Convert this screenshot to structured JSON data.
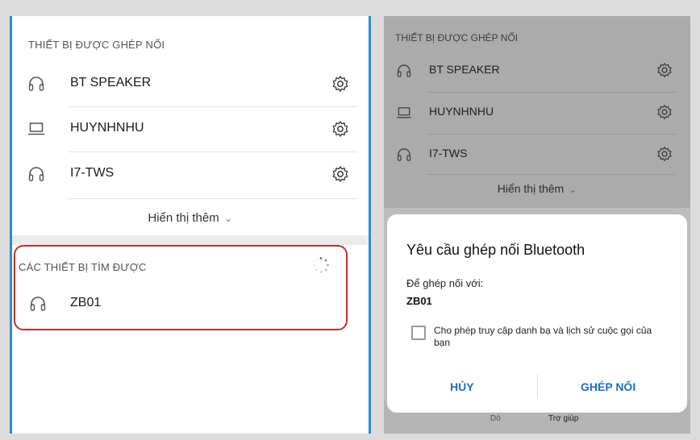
{
  "left": {
    "paired_header": "THIẾT BỊ ĐƯỢC GHÉP NỐI",
    "paired_devices": [
      {
        "label": "BT SPEAKER",
        "icon": "headphones-icon"
      },
      {
        "label": "HUYNHNHU",
        "icon": "laptop-icon"
      },
      {
        "label": "I7-TWS",
        "icon": "headphones-icon"
      }
    ],
    "show_more": "Hiển thị thêm",
    "found_header": "CÁC THIẾT BỊ TÌM ĐƯỢC",
    "found_devices": [
      {
        "label": "ZB01",
        "icon": "headphones-icon"
      }
    ]
  },
  "right": {
    "paired_header": "THIẾT BỊ ĐƯỢC GHÉP NỐI",
    "paired_devices": [
      {
        "label": "BT SPEAKER",
        "icon": "headphones-icon"
      },
      {
        "label": "HUYNHNHU",
        "icon": "laptop-icon"
      },
      {
        "label": "I7-TWS",
        "icon": "headphones-icon"
      }
    ],
    "show_more": "Hiển thị thêm",
    "bottom_nav": {
      "left": "Dò",
      "right": "Trợ giúp"
    }
  },
  "dialog": {
    "title": "Yêu cầu ghép nối Bluetooth",
    "subtitle": "Để ghép nối với:",
    "device": "ZB01",
    "checkbox_label": "Cho phép truy cập danh bạ và lịch sử cuộc gọi của bạn",
    "cancel": "HỦY",
    "pair": "GHÉP NỐI"
  },
  "colors": {
    "accent_blue": "#2a8fd1",
    "highlight_red": "#c0312f",
    "dialog_button": "#1f6fbf"
  }
}
